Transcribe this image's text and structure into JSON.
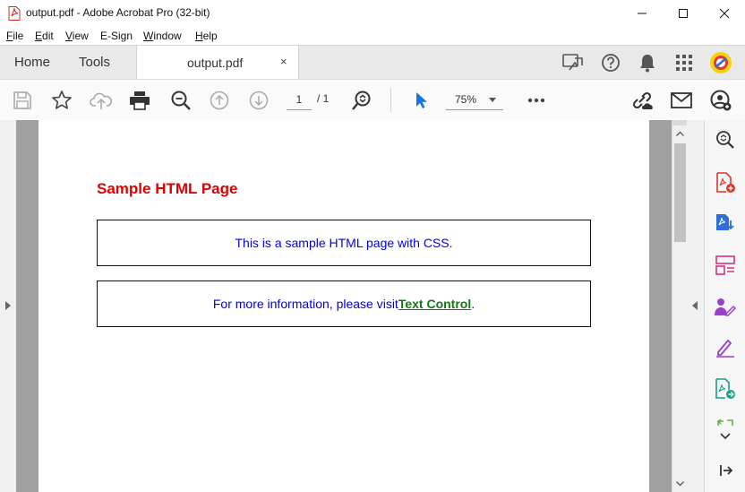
{
  "window": {
    "title": "output.pdf - Adobe Acrobat Pro (32-bit)",
    "controls": [
      "minimize-icon",
      "maximize-icon",
      "close-icon"
    ]
  },
  "menu": {
    "items": [
      {
        "key": "F",
        "rest": "ile"
      },
      {
        "key": "E",
        "rest": "dit"
      },
      {
        "key": "V",
        "rest": "iew"
      },
      {
        "key": "",
        "rest": "E-Sign"
      },
      {
        "key": "W",
        "rest": "indow"
      },
      {
        "key": "H",
        "rest": "elp"
      }
    ]
  },
  "tabs": {
    "home": "Home",
    "tools": "Tools",
    "document": "output.pdf",
    "close_glyph": "×"
  },
  "toolbar": {
    "page_current": "1",
    "page_total": "/ 1",
    "zoom": "75%",
    "icons": [
      "save-icon",
      "bookmark-star-icon",
      "upload-cloud-icon",
      "print-icon",
      "zoom-out-icon",
      "page-up-icon",
      "page-down-icon",
      "zoom-in-search-icon",
      "select-cursor-icon",
      "more-icon",
      "share-link-icon",
      "email-icon",
      "account-icon"
    ]
  },
  "document": {
    "heading": "Sample HTML Page",
    "box1_text": "This is a sample HTML page with CSS.",
    "box2_prefix": "For more information, please visit ",
    "box2_link": "Text Control",
    "box2_suffix": "."
  },
  "colors": {
    "heading": "#e00000",
    "body_text": "#0000e6",
    "link": "#127a12",
    "acrobat_red": "#e0342c",
    "cursor_blue": "#1473e6",
    "purple": "#9b3fcf",
    "teal": "#16a085"
  }
}
